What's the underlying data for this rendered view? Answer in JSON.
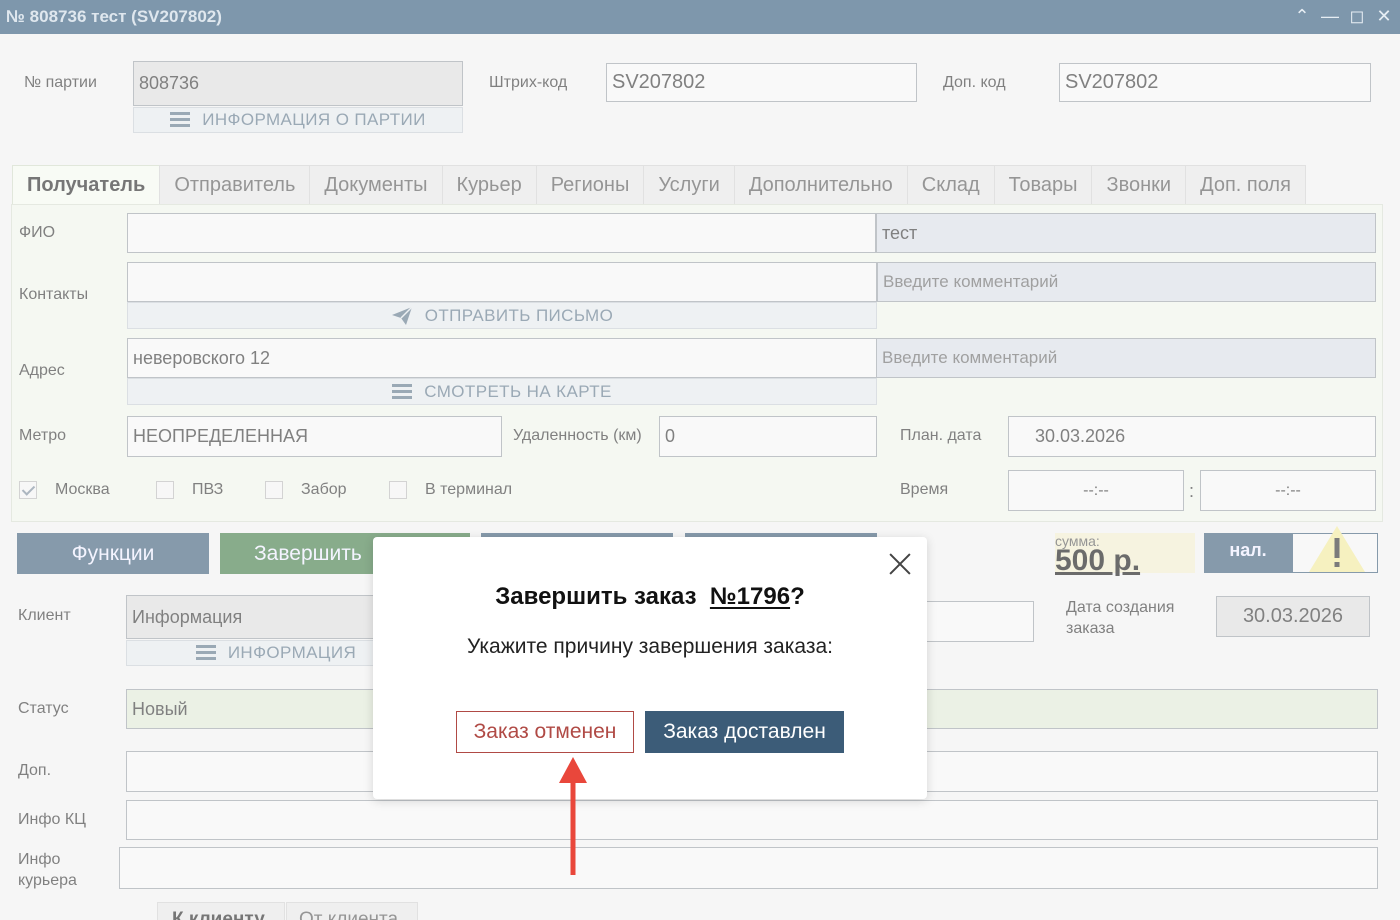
{
  "window": {
    "title": "№ 808736 тест (SV207802)"
  },
  "header": {
    "batch_label": "№ партии",
    "batch_value": "808736",
    "batch_info_link": "ИНФОРМАЦИЯ О ПАРТИИ",
    "barcode_label": "Штрих-код",
    "barcode_value": "SV207802",
    "extra_code_label": "Доп. код",
    "extra_code_value": "SV207802"
  },
  "tabs": [
    {
      "label": "Получатель",
      "active": true
    },
    {
      "label": "Отправитель"
    },
    {
      "label": "Документы"
    },
    {
      "label": "Курьер"
    },
    {
      "label": "Регионы"
    },
    {
      "label": "Услуги"
    },
    {
      "label": "Дополнительно"
    },
    {
      "label": "Склад"
    },
    {
      "label": "Товары"
    },
    {
      "label": "Звонки"
    },
    {
      "label": "Доп. поля"
    }
  ],
  "recipient": {
    "fio_label": "ФИО",
    "fio_value": "",
    "fio_comment": "тест",
    "contacts_label": "Контакты",
    "contacts_value": "",
    "contacts_comment_placeholder": "Введите комментарий",
    "send_letter": "ОТПРАВИТЬ ПИСЬМО",
    "address_label": "Адрес",
    "address_value": "неверовского 12",
    "address_comment_placeholder": "Введите  комментарий",
    "show_map": "СМОТРЕТЬ НА КАРТЕ",
    "metro_label": "Метро",
    "metro_value": "НЕОПРЕДЕЛЕННАЯ",
    "distance_label": "Удаленность (км)",
    "distance_value": "0",
    "plan_date_label": "План. дата",
    "plan_date_value": "30.03.2026",
    "time_label": "Время",
    "time_from": "--:--",
    "time_sep": ":",
    "time_to": "--:--",
    "checkboxes": [
      {
        "label": "Москва",
        "checked": true
      },
      {
        "label": "ПВЗ",
        "checked": false
      },
      {
        "label": "Забор",
        "checked": false
      },
      {
        "label": "В терминал",
        "checked": false
      }
    ]
  },
  "actions": {
    "functions": "Функции",
    "complete": "Завершить",
    "sum_label": "сумма:",
    "sum_value": "500 р.",
    "payment": "нал.",
    "warning_icon": "warning-icon"
  },
  "lower": {
    "client_label": "Клиент",
    "client_value": "Информация",
    "client_info_link": "ИНФОРМАЦИЯ",
    "created_label": "Дата создания заказа",
    "created_value": "30.03.2026",
    "status_label": "Статус",
    "status_value": "Новый",
    "extra_label": "Доп.",
    "kc_label": "Инфо КЦ",
    "courier_info_label": "Инфо курьера",
    "bottom_tab_1": "К клиенту",
    "bottom_tab_2": "От клиента"
  },
  "modal": {
    "title_prefix": "Завершить заказ",
    "order_number": "№1796",
    "title_suffix": "?",
    "subtitle": "Укажите причину завершения заказа:",
    "cancel_button": "Заказ отменен",
    "delivered_button": "Заказ доставлен"
  },
  "colors": {
    "titlebar": "#7e97ac",
    "primary_button": "#3c5c78",
    "complete_button": "#3f7a45",
    "cancel_border": "#b04a45",
    "arrow": "#e9473b"
  }
}
